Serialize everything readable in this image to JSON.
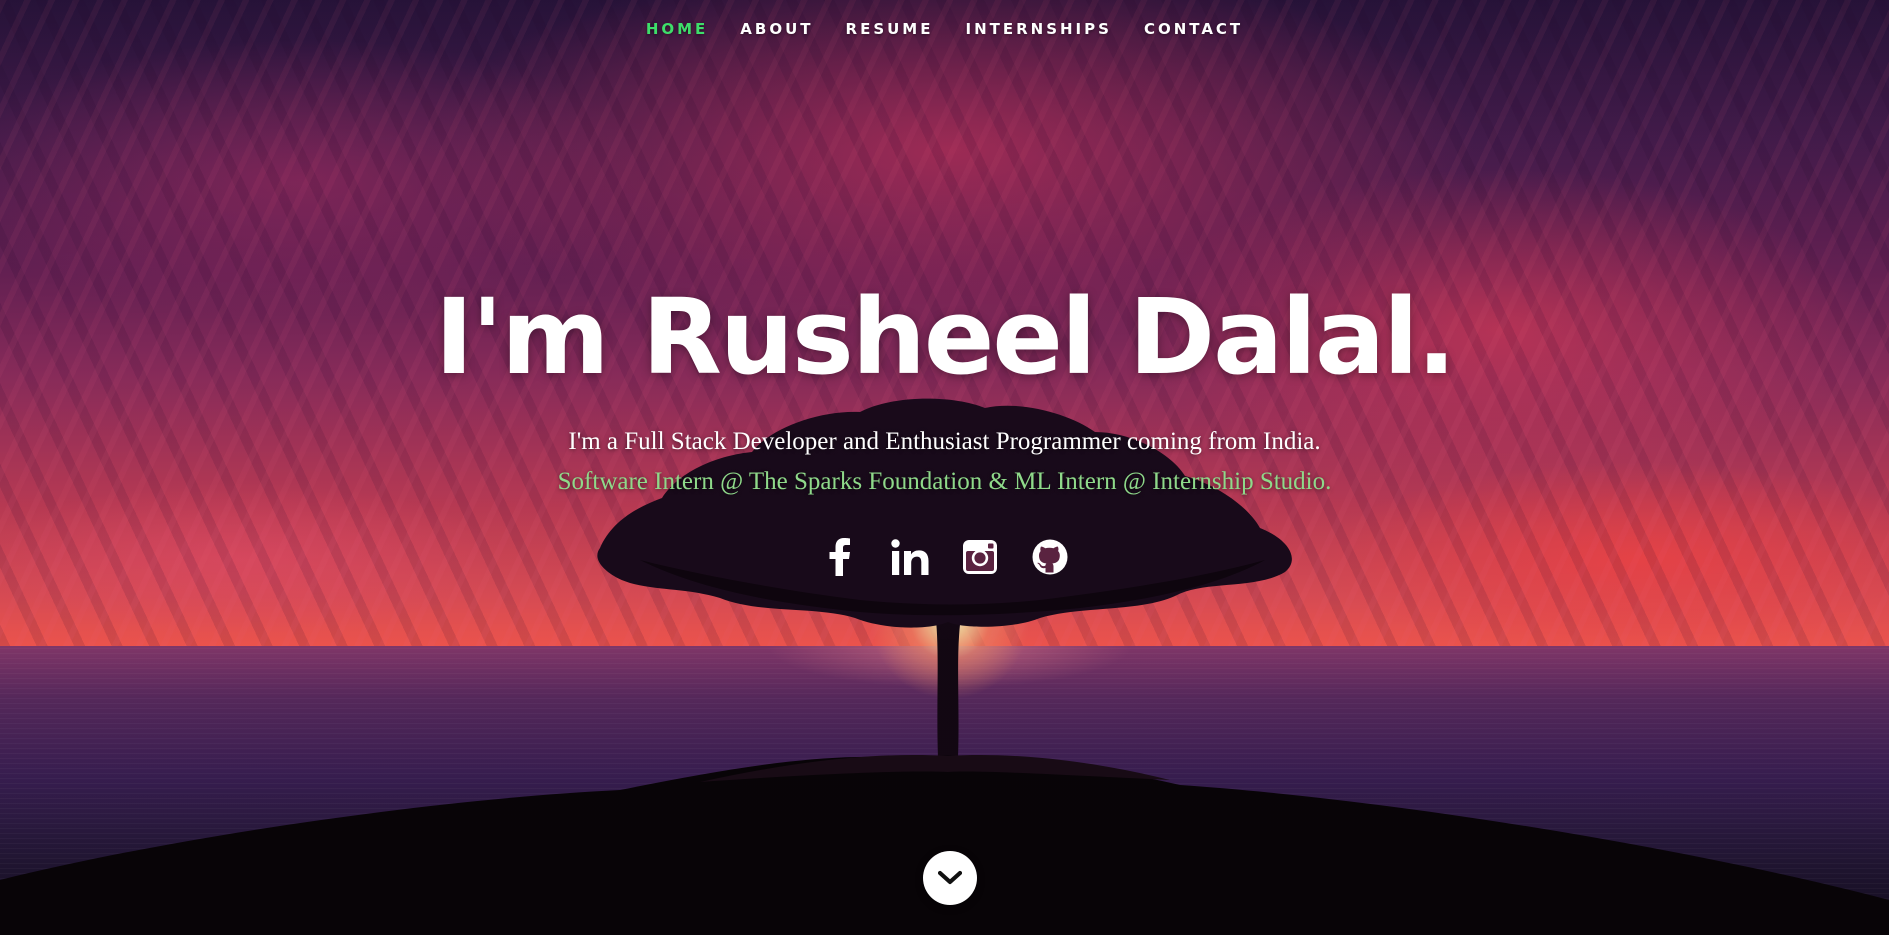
{
  "nav": {
    "items": [
      {
        "label": "Home",
        "active": true
      },
      {
        "label": "About",
        "active": false
      },
      {
        "label": "Resume",
        "active": false
      },
      {
        "label": "Internships",
        "active": false
      },
      {
        "label": "Contact",
        "active": false
      }
    ]
  },
  "banner": {
    "headline": "I'm Rusheel Dalal.",
    "lead": "I'm a Full Stack Developer and Enthusiast Programmer coming from India.",
    "lead_highlight": "Software Intern @ The Sparks Foundation & ML Intern @ Internship Studio."
  },
  "social": {
    "icons": [
      "facebook-icon",
      "linkedin-icon",
      "instagram-icon",
      "github-icon"
    ]
  },
  "scroll_down": {
    "icon": "chevron-down-icon"
  },
  "colors": {
    "active_nav": "#3ede6a",
    "highlight_text": "#8fd98a",
    "text": "#ffffff"
  }
}
